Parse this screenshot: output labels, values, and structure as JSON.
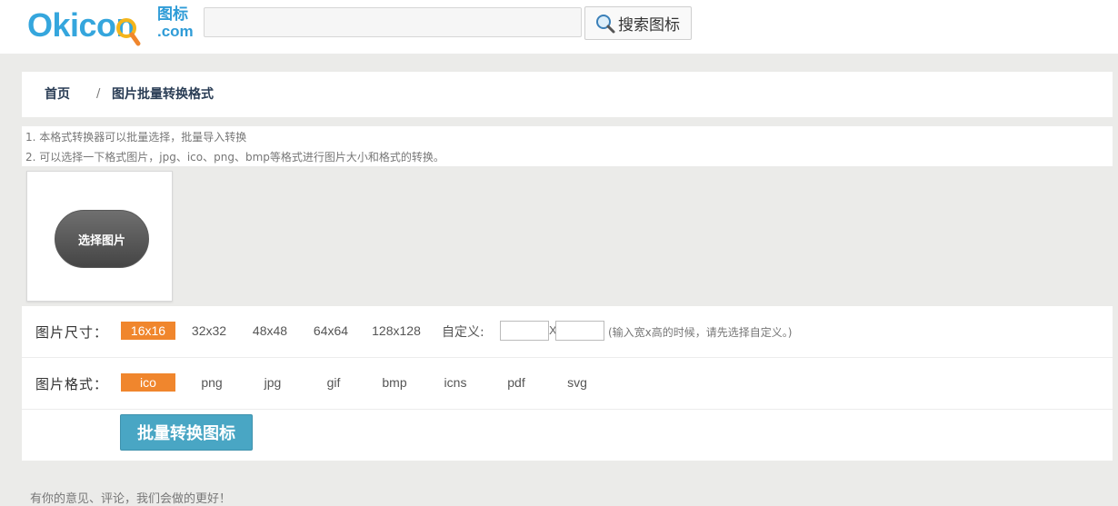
{
  "brand": {
    "logo_text": "Okicon",
    "logo_cn": "图标",
    "logo_domain": ".com"
  },
  "search": {
    "placeholder": "",
    "button_label": "搜索图标",
    "button_icon": "search-magnifier-icon"
  },
  "breadcrumb": {
    "home": "首页",
    "separator": "/",
    "current": "图片批量转换格式"
  },
  "notes": [
    "1. 本格式转换器可以批量选择，批量导入转换",
    "2. 可以选择一下格式图片，jpg、ico、png、bmp等格式进行图片大小和格式的转换。"
  ],
  "upload": {
    "button_label": "选择图片"
  },
  "size_options": {
    "label": "图片尺寸：",
    "options": [
      "16x16",
      "32x32",
      "48x48",
      "64x64",
      "128x128"
    ],
    "selected": "16x16",
    "custom_label": "自定义:",
    "separator": "X",
    "width_value": "",
    "height_value": "",
    "hint": "(输入宽x高的时候，请先选择自定义。)"
  },
  "format_options": {
    "label": "图片格式：",
    "options": [
      "ico",
      "png",
      "jpg",
      "gif",
      "bmp",
      "icns",
      "pdf",
      "svg"
    ],
    "selected": "ico"
  },
  "convert": {
    "button_label": "批量转换图标"
  },
  "footer": {
    "text": "有你的意见、评论，我们会做的更好！"
  },
  "colors": {
    "accent_orange": "#f0862d",
    "button_blue": "#49a6c4",
    "logo_blue": "#35a6dd",
    "page_bg": "#ebebe9"
  }
}
